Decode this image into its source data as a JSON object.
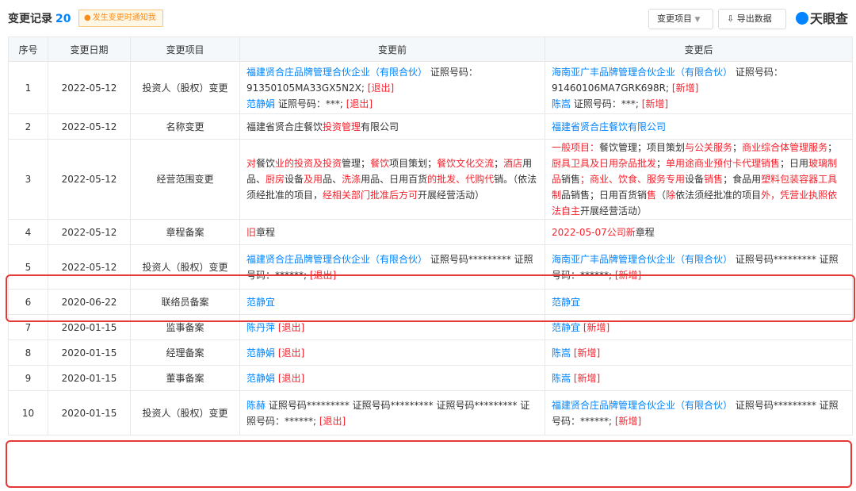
{
  "header": {
    "title": "变更记录",
    "count": "20",
    "notify_label": "发生变更时通知我",
    "filter_label": "变更项目",
    "export_label": "导出数据",
    "logo_text": "天眼查"
  },
  "table": {
    "columns": [
      "序号",
      "变更日期",
      "变更项目",
      "变更前",
      "变更后"
    ],
    "rows": [
      {
        "no": "1",
        "date": "2022-05-12",
        "item": "投资人（股权）变更",
        "before": [
          [
            "福建贤合庄品牌管理合伙企业（有限合伙）",
            "b"
          ],
          [
            "  证照号码：91350105MA33GX5N2X; ",
            "n"
          ],
          [
            "[退出]",
            "r"
          ],
          [
            "BR",
            "n"
          ],
          [
            "范静娟",
            "b"
          ],
          [
            " 证照号码：***; ",
            "n"
          ],
          [
            "[退出]",
            "r"
          ]
        ],
        "after": [
          [
            "海南亚广丰品牌管理合伙企业（有限合伙）",
            "b"
          ],
          [
            "  证照号码：91460106MA7GRK698R; ",
            "n"
          ],
          [
            "[新增]",
            "r"
          ],
          [
            "BR",
            "n"
          ],
          [
            "陈嵩",
            "b"
          ],
          [
            " 证照号码：***; ",
            "n"
          ],
          [
            "[新增]",
            "r"
          ]
        ]
      },
      {
        "no": "2",
        "date": "2022-05-12",
        "item": "名称变更",
        "before": [
          [
            "福建省贤合庄餐饮",
            "n"
          ],
          [
            "投资管理",
            "r"
          ],
          [
            "有限公司",
            "n"
          ]
        ],
        "after": [
          [
            "福建省贤合庄餐饮有限公司",
            "b"
          ]
        ]
      },
      {
        "no": "3",
        "date": "2022-05-12",
        "item": "经营范围变更",
        "before": [
          [
            "对",
            "r"
          ],
          [
            "餐饮",
            "n"
          ],
          [
            "业的投资及投资",
            "r"
          ],
          [
            "管理；",
            "n"
          ],
          [
            "餐饮",
            "r"
          ],
          [
            "项目策划；",
            "n"
          ],
          [
            "餐饮文化交流",
            "r"
          ],
          [
            "；",
            "n"
          ],
          [
            "酒店",
            "r"
          ],
          [
            "用品、",
            "n"
          ],
          [
            "厨房",
            "r"
          ],
          [
            "设备",
            "n"
          ],
          [
            "及用",
            "r"
          ],
          [
            "品、",
            "n"
          ],
          [
            "洗涤",
            "r"
          ],
          [
            "用品、日用百货",
            "n"
          ],
          [
            "的批发、代购代",
            "r"
          ],
          [
            "销。（依法须经批准的项目，",
            "n"
          ],
          [
            "经相关部门批准后方可",
            "r"
          ],
          [
            "开展经营活动）",
            "n"
          ]
        ],
        "after": [
          [
            "一般项目：",
            "r"
          ],
          [
            "餐饮管理；项目策划",
            "n"
          ],
          [
            "与公关服务",
            "r"
          ],
          [
            "；",
            "n"
          ],
          [
            "商业综合体管理服务",
            "r"
          ],
          [
            "；",
            "n"
          ],
          [
            "厨具卫具及日用杂品批发",
            "r"
          ],
          [
            "；",
            "n"
          ],
          [
            "单用途商业预付卡代理销售",
            "r"
          ],
          [
            "；日用",
            "n"
          ],
          [
            "玻璃制品",
            "r"
          ],
          [
            "销售",
            "n"
          ],
          [
            "；商业、饮食、服务专用",
            "r"
          ],
          [
            "设备",
            "n"
          ],
          [
            "销售",
            "r"
          ],
          [
            "；食品用",
            "n"
          ],
          [
            "塑料包装容器工具制",
            "r"
          ],
          [
            "品销售；日用百货销",
            "n"
          ],
          [
            "售",
            "r"
          ],
          [
            "（",
            "n"
          ],
          [
            "除",
            "r"
          ],
          [
            "依法须经批准的项目",
            "n"
          ],
          [
            "外，凭营业执照依法自主",
            "r"
          ],
          [
            "开展经营活动）",
            "n"
          ]
        ]
      },
      {
        "no": "4",
        "date": "2022-05-12",
        "item": "章程备案",
        "before": [
          [
            "旧",
            "r"
          ],
          [
            "章程",
            "n"
          ]
        ],
        "after": [
          [
            "2022-05-07公司新",
            "r"
          ],
          [
            "章程",
            "n"
          ]
        ]
      },
      {
        "no": "5",
        "date": "2022-05-12",
        "item": "投资人（股权）变更",
        "before": [
          [
            "福建贤合庄品牌管理合伙企业（有限合伙）",
            "b"
          ],
          [
            "  证照号码********* 证照号码：******; ",
            "n"
          ],
          [
            "[退出]",
            "r"
          ]
        ],
        "after": [
          [
            "海南亚广丰品牌管理合伙企业（有限合伙）",
            "b"
          ],
          [
            "  证照号码********* 证照号码：******; ",
            "n"
          ],
          [
            "[新增]",
            "r"
          ]
        ]
      },
      {
        "no": "6",
        "date": "2020-06-22",
        "item": "联络员备案",
        "before": [
          [
            "范静宜",
            "b"
          ]
        ],
        "after": [
          [
            "范静宜",
            "b"
          ]
        ]
      },
      {
        "no": "7",
        "date": "2020-01-15",
        "item": "监事备案",
        "before": [
          [
            "陈丹萍",
            "b"
          ],
          [
            " [退出]",
            "r"
          ]
        ],
        "after": [
          [
            "范静宜",
            "b"
          ],
          [
            " [新增]",
            "r"
          ]
        ]
      },
      {
        "no": "8",
        "date": "2020-01-15",
        "item": "经理备案",
        "before": [
          [
            "范静娟",
            "b"
          ],
          [
            " [退出]",
            "r"
          ]
        ],
        "after": [
          [
            "陈嵩",
            "b"
          ],
          [
            " [新增]",
            "r"
          ]
        ]
      },
      {
        "no": "9",
        "date": "2020-01-15",
        "item": "董事备案",
        "before": [
          [
            "范静娟",
            "b"
          ],
          [
            " [退出]",
            "r"
          ]
        ],
        "after": [
          [
            "陈嵩",
            "b"
          ],
          [
            " [新增]",
            "r"
          ]
        ]
      },
      {
        "no": "10",
        "date": "2020-01-15",
        "item": "投资人（股权）变更",
        "before": [
          [
            "陈赫",
            "b"
          ],
          [
            " 证照号码********* 证照号码********* 证照号码********* 证照号码：******; ",
            "n"
          ],
          [
            "[退出]",
            "r"
          ]
        ],
        "after": [
          [
            "福建贤合庄品牌管理合伙企业（有限合伙）",
            "b"
          ],
          [
            "  证照号码********* 证照号码：******; ",
            "n"
          ],
          [
            "[新增]",
            "r"
          ]
        ]
      }
    ]
  },
  "colors": {
    "accent": "#0084ff",
    "highlight": "#e53935",
    "warn": "#fa8c16",
    "change": "#f5222d"
  }
}
